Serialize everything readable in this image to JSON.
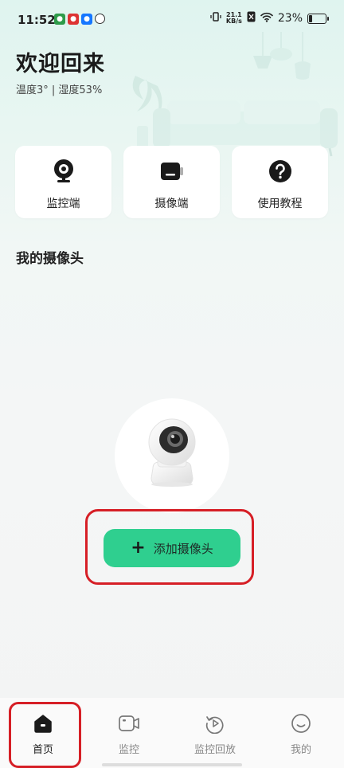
{
  "status_bar": {
    "time": "11:52",
    "net_speed_value": "21.1",
    "net_speed_unit": "KB/s",
    "battery_percent": "23%",
    "battery_level": 0.23
  },
  "header": {
    "welcome": "欢迎回来",
    "weather": "温度3° | 湿度53%"
  },
  "quick_actions": [
    {
      "label": "监控端",
      "icon": "webcam-icon"
    },
    {
      "label": "摄像端",
      "icon": "camera-device-icon"
    },
    {
      "label": "使用教程",
      "icon": "help-icon"
    }
  ],
  "cameras": {
    "title": "我的摄像头",
    "add_label": "添加摄像头"
  },
  "tabbar": {
    "items": [
      {
        "label": "首页",
        "icon": "home-icon",
        "active": true
      },
      {
        "label": "监控",
        "icon": "video-icon",
        "active": false
      },
      {
        "label": "监控回放",
        "icon": "replay-icon",
        "active": false
      },
      {
        "label": "我的",
        "icon": "smiley-icon",
        "active": false
      }
    ]
  },
  "colors": {
    "accent": "#2fcf8f",
    "annotation": "#d61f26"
  }
}
